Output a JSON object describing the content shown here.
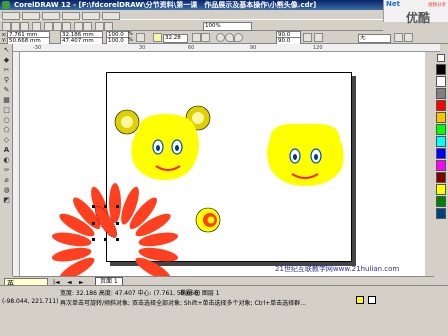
{
  "window": {
    "title": "CorelDRAW 12 - [F:\\fdcorelDRAW\\分节资料\\第一课　作品展示及基本操作\\小熊头像.cdr]"
  },
  "logo_text": "优酷",
  "logo_sub": "视频分享",
  "logo_brand": "Net",
  "toolbar": {
    "zoom": "100%"
  },
  "property_bar": {
    "x": "7.761 mm",
    "y": "50.668 mm",
    "width": "32.186 mm",
    "height": "47.407 mm",
    "scale_x": "100.0",
    "scale_y": "100.0",
    "scale_unit": "%",
    "rotation": "32.28",
    "angle1": "90.0",
    "angle2": "90.0",
    "outline": "无"
  },
  "rulers": {
    "top_ticks": [
      "-30",
      "",
      "",
      "30",
      "",
      "60",
      "",
      "90",
      "",
      "120"
    ]
  },
  "page_tab": {
    "label": "页面 1"
  },
  "ime": {
    "label": "英"
  },
  "status": {
    "line1": "宽度: 32.186  高度: 47.407  中心: (7.761, 50.668)",
    "line2_coords": "(-98.044, 221.711)",
    "line2_hint": "再次单击可旋转/倾斜对象; 双击选择全部对象; Shift+单击选择多个对象; Ctrl+单击选择群...",
    "layer": "椭圆 在 图层 1",
    "watermark": "21世纪互联教学网www.21hulian.com"
  },
  "colors": {
    "accent": "#0a246a",
    "bear_face": "#ffff00",
    "bear_ear": "#e0d000",
    "flower": "#ff4020",
    "mouth": "#ff2020",
    "eye": "#0050c0"
  },
  "palette_colors": [
    "#000000",
    "#ffffff",
    "#808080",
    "#ff0000",
    "#ffc000",
    "#00ff00",
    "#00ffff",
    "#0000ff",
    "#ff00ff",
    "#800000",
    "#ffff00",
    "#008000",
    "#004080"
  ]
}
